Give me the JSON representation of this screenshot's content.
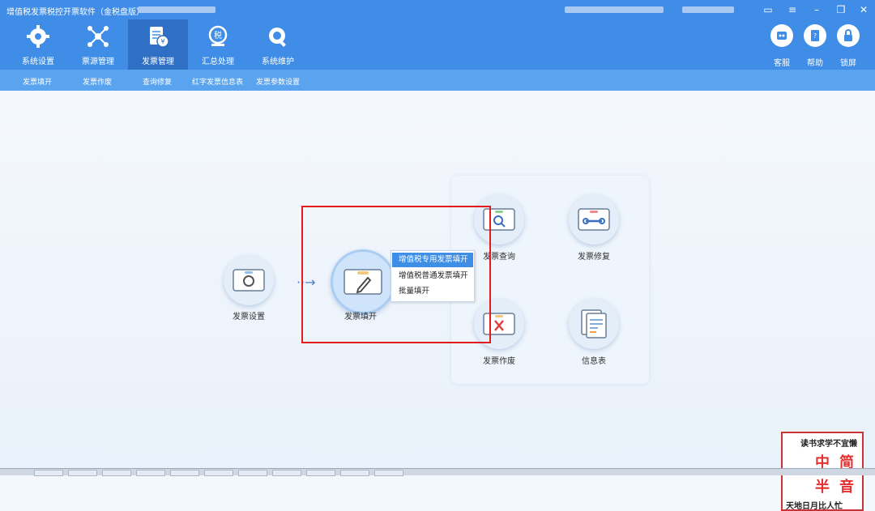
{
  "window": {
    "title": "增值税发票税控开票软件（金税盘版）"
  },
  "toolbar": {
    "items": [
      {
        "label": "系统设置",
        "icon": "gear-icon"
      },
      {
        "label": "票源管理",
        "icon": "network-icon"
      },
      {
        "label": "发票管理",
        "icon": "invoice-icon",
        "active": true
      },
      {
        "label": "汇总处理",
        "icon": "tax-summary-icon"
      },
      {
        "label": "系统维护",
        "icon": "maintenance-icon"
      }
    ],
    "right": [
      {
        "label": "客服",
        "icon": "robot-icon"
      },
      {
        "label": "帮助",
        "icon": "help-book-icon"
      },
      {
        "label": "锁屏",
        "icon": "lock-icon"
      }
    ]
  },
  "subnav": [
    "发票填开",
    "发票作废",
    "查询修复",
    "红字发票信息表",
    "发票参数设置"
  ],
  "flow": {
    "settings": "发票设置",
    "issue": "发票填开",
    "query": "发票查询",
    "repair": "发票修复",
    "void": "发票作废",
    "info": "信息表"
  },
  "menu": {
    "items": [
      "增值税专用发票填开",
      "增值税普通发票填开",
      "批量填开"
    ],
    "selected": 0
  },
  "watermark": {
    "top": "读书求学不宜懒",
    "mid1": "中",
    "mid2": "简",
    "mid3": "半",
    "mid4": "音",
    "bottom": "天地日月比人忙"
  },
  "colors": {
    "accent": "#3f8de6",
    "highlight": "#e21c1c"
  }
}
